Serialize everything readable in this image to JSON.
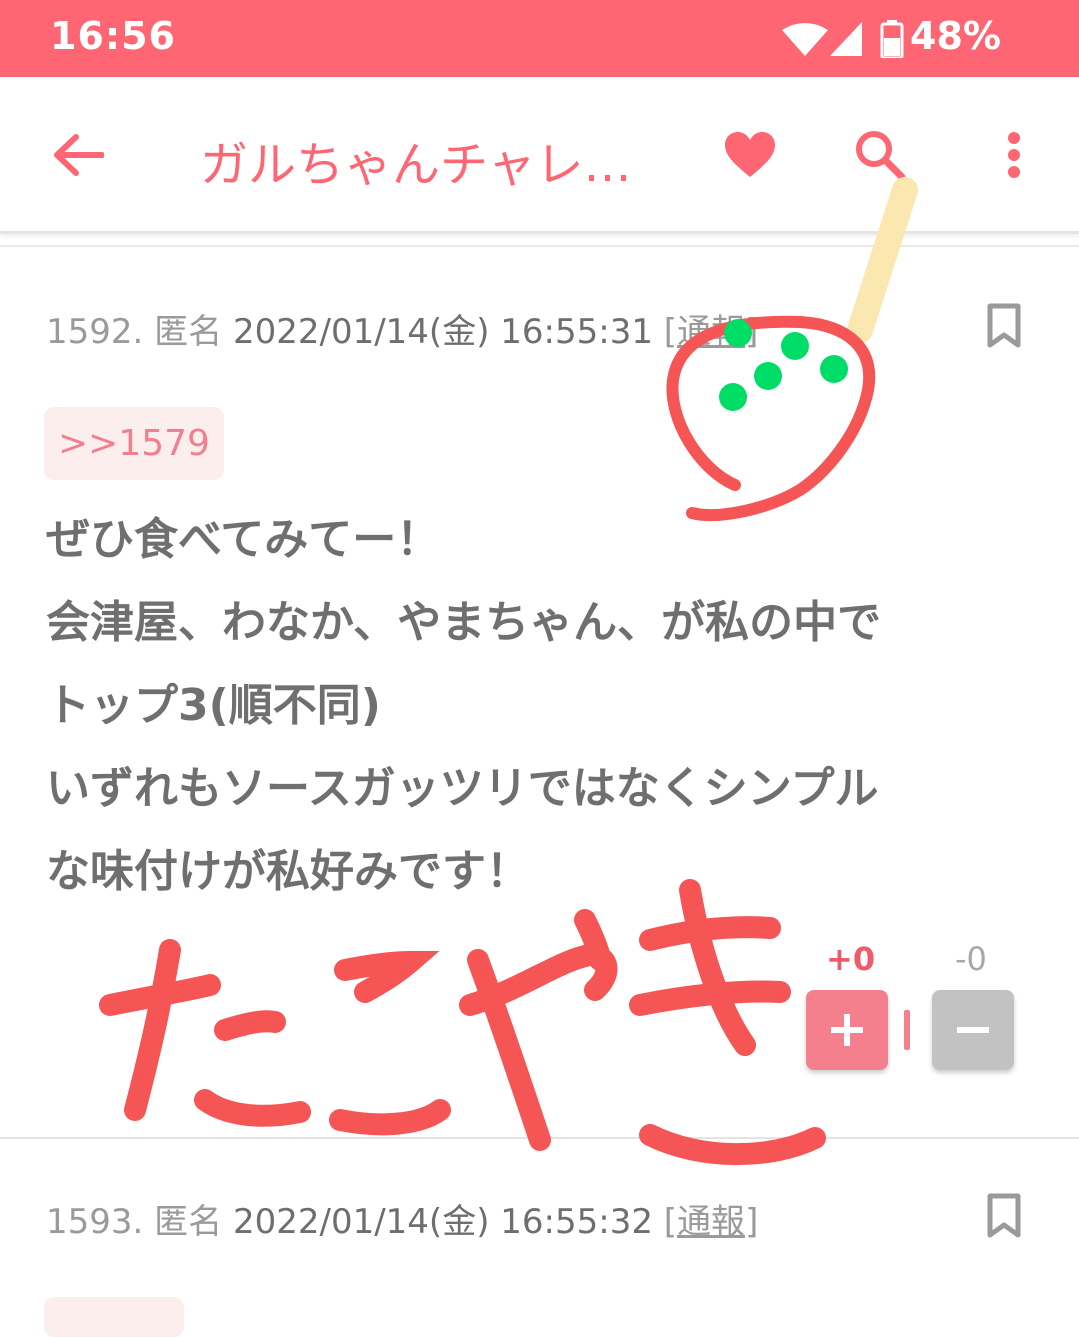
{
  "status_bar": {
    "time": "16:56",
    "battery": "48%"
  },
  "toolbar": {
    "title": "ガルちゃんチャレ…"
  },
  "posts": [
    {
      "number": "1592.",
      "author": "匿名",
      "datetime": "2022/01/14(金) 16:55:31",
      "report_open": "[",
      "report": "通報",
      "report_close": "]",
      "reply_to": ">>1579",
      "lines": [
        "ぜひ食べてみてー！",
        "会津屋、わなか、やまちゃん、が私の中で",
        "トップ3(順不同)",
        "いずれもソースガッツリではなくシンプル",
        "な味付けが私好みです！"
      ],
      "plus_count": "+0",
      "minus_count": "-0"
    },
    {
      "number": "1593.",
      "author": "匿名",
      "datetime": "2022/01/14(金) 16:55:32",
      "report_open": "[",
      "report": "通報",
      "report_close": "]"
    }
  ],
  "drawing": {
    "handwritten": "たこやき"
  },
  "colors": {
    "accent": "#fe6674",
    "plus": "#f4808e",
    "minus": "#c2c2c2",
    "ink": "#f55555",
    "dots": "#00dd66"
  }
}
